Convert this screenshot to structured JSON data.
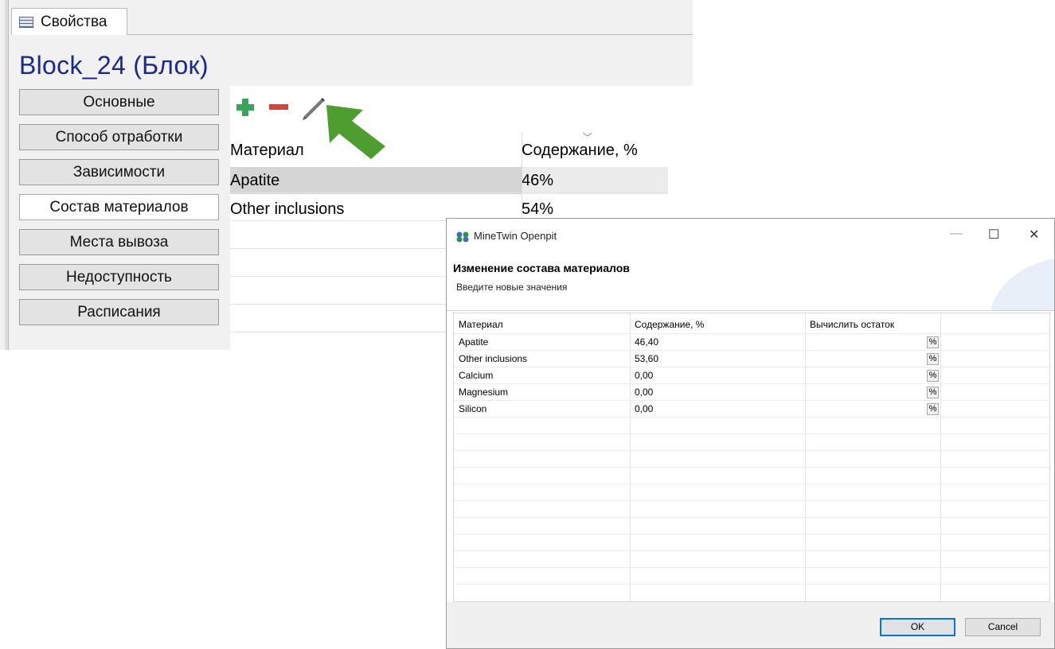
{
  "panel": {
    "tab_label": "Свойства",
    "object_title": "Block_24 (Блок)",
    "nav": [
      "Основные",
      "Способ отработки",
      "Зависимости",
      "Состав материалов",
      "Места вывоза",
      "Недоступность",
      "Расписания"
    ],
    "active_nav": "Состав материалов",
    "toolbar": {
      "add_icon": "plus-icon",
      "remove_icon": "minus-icon",
      "edit_icon": "pencil-icon",
      "arrow_icon": "green-arrow-icon",
      "add_color": "#3aa35a",
      "remove_color": "#d9423a",
      "arrow_color": "#4d9e2e"
    },
    "grid": {
      "headers": [
        "Материал",
        "Содержание, %"
      ],
      "rows": [
        [
          "Apatite",
          "46%"
        ],
        [
          "Other inclusions",
          "54%"
        ]
      ],
      "selected_row": 0
    }
  },
  "dialog": {
    "app_title": "MineTwin Openpit",
    "heading": "Изменение состава материалов",
    "subheading": "Введите новые значения",
    "columns": [
      "Материал",
      "Содержание, %",
      "Вычислить остаток"
    ],
    "rows": [
      {
        "material": "Apatite",
        "content": "46,40",
        "calc": "%"
      },
      {
        "material": "Other inclusions",
        "content": "53,60",
        "calc": "%"
      },
      {
        "material": "Calcium",
        "content": "0,00",
        "calc": "%"
      },
      {
        "material": "Magnesium",
        "content": "0,00",
        "calc": "%"
      },
      {
        "material": "Silicon",
        "content": "0,00",
        "calc": "%"
      }
    ],
    "window_buttons": {
      "minimize": "—",
      "maximize": "☐",
      "close": "✕"
    },
    "ok_label": "OK",
    "cancel_label": "Cancel",
    "accent": "#0078d7"
  }
}
